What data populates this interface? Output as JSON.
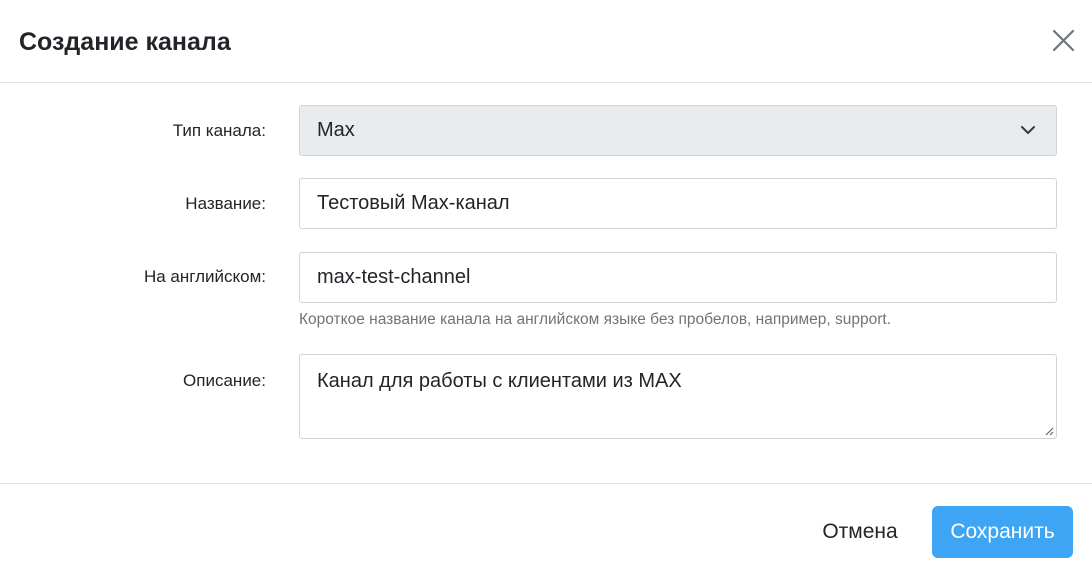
{
  "modal": {
    "title": "Создание канала",
    "close_icon": "close-icon"
  },
  "form": {
    "channel_type": {
      "label": "Тип канала:",
      "selected": "Max",
      "icon": "chevron-down-icon"
    },
    "name": {
      "label": "Название:",
      "value": "Тестовый Max-канал"
    },
    "english_name": {
      "label": "На английском:",
      "value": "max-test-channel",
      "help": "Короткое название канала на английском языке без пробелов, например, support."
    },
    "description": {
      "label": "Описание:",
      "value": "Канал для работы с клиентами из MAX"
    }
  },
  "footer": {
    "cancel_label": "Отмена",
    "save_label": "Сохранить"
  },
  "colors": {
    "primary": "#3da5f4",
    "select_bg": "#e9ecef",
    "border": "#ced4da",
    "muted_text": "#6c757d"
  }
}
